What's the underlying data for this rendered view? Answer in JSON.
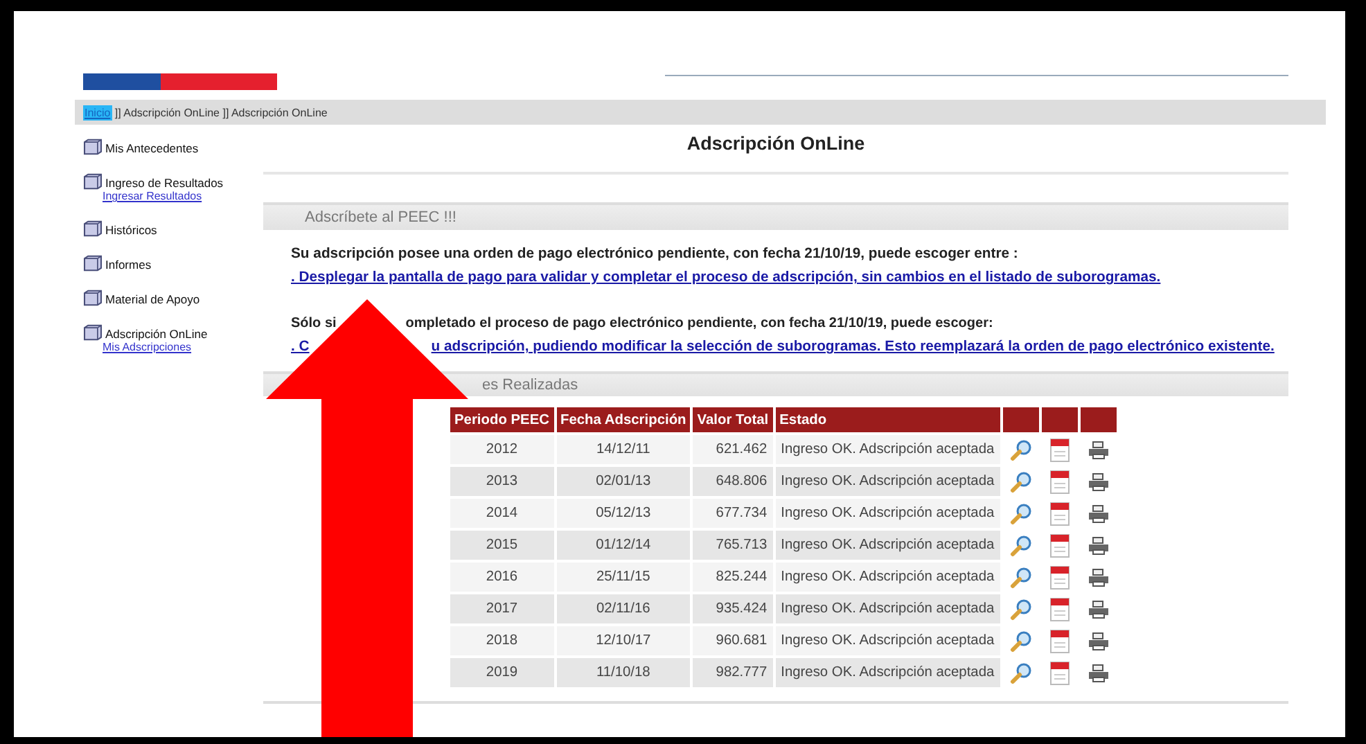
{
  "breadcrumb": {
    "home": "Inicio",
    "items": [
      " ]] Adscripción OnLine",
      " ]] Adscripción OnLine"
    ]
  },
  "sidebar": {
    "items": [
      {
        "label": "Mis Antecedentes"
      },
      {
        "label": "Ingreso de Resultados",
        "sublinks": [
          "Ingresar Resultados"
        ]
      },
      {
        "label": "Históricos"
      },
      {
        "label": "Informes"
      },
      {
        "label": "Material de Apoyo"
      },
      {
        "label": "Adscripción OnLine",
        "sublinks": [
          "Mis Adscripciones"
        ]
      }
    ]
  },
  "title": "Adscripción OnLine",
  "section_1": {
    "header": "Adscríbete al PEEC !!!",
    "notice_1": [
      "Su adscripción posee una orden de pago electrónico pendiente, con fecha 21/10/19, puede escoger entre :"
    ],
    "link_1": [
      ". Desplegar la pantalla de pago para validar y completar el proceso de adscripción, sin cambios en el listado de suborogramas."
    ],
    "notice_2": [
      "Sólo si",
      "ompletado el proceso de pago electrónico pendiente, con fecha 21/10/19, puede escoger:"
    ],
    "link_2": [
      ". C",
      "u adscripción, pudiendo modificar la selección de suborogramas. Esto reemplazará la orden de pago electrónico existente."
    ]
  },
  "section_2": {
    "header": "es Realizadas"
  },
  "table": {
    "columns": [
      "Periodo PEEC",
      "Fecha Adscripción",
      "Valor Total",
      "Estado"
    ],
    "rows": [
      [
        "2012",
        "14/12/11",
        "621.462",
        "Ingreso OK. Adscripción aceptada"
      ],
      [
        "2013",
        "02/01/13",
        "648.806",
        "Ingreso OK. Adscripción aceptada"
      ],
      [
        "2014",
        "05/12/13",
        "677.734",
        "Ingreso OK. Adscripción aceptada"
      ],
      [
        "2015",
        "01/12/14",
        "765.713",
        "Ingreso OK. Adscripción aceptada"
      ],
      [
        "2016",
        "25/11/15",
        "825.244",
        "Ingreso OK. Adscripción aceptada"
      ],
      [
        "2017",
        "02/11/16",
        "935.424",
        "Ingreso OK. Adscripción aceptada"
      ],
      [
        "2018",
        "12/10/17",
        "960.681",
        "Ingreso OK. Adscripción aceptada"
      ],
      [
        "2019",
        "11/10/18",
        "982.777",
        "Ingreso OK. Adscripción aceptada"
      ]
    ]
  }
}
